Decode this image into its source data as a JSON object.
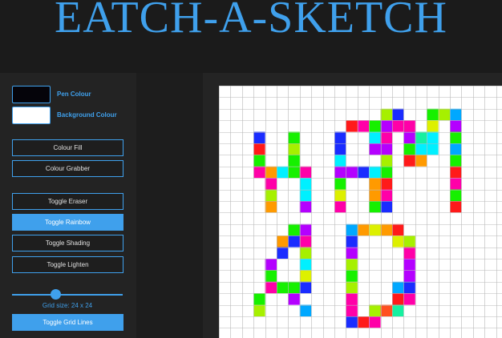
{
  "header": {
    "title": "EATCH-A-SKETCH"
  },
  "controls": {
    "pen_colour_label": "Pen Colour",
    "pen_colour_value": "#05040a",
    "background_colour_label": "Background Colour",
    "background_colour_value": "#ffffff",
    "colour_fill_label": "Colour Fill",
    "colour_grabber_label": "Colour Grabber",
    "toggle_eraser_label": "Toggle Eraser",
    "toggle_rainbow_label": "Toggle Rainbow",
    "toggle_shading_label": "Toggle Shading",
    "toggle_lighten_label": "Toggle Lighten",
    "grid_size_label": "Grid size: 24 x 24",
    "grid_size_value": 24,
    "toggle_grid_lines_label": "Toggle Grid Lines",
    "active_toggle": "Toggle Rainbow"
  },
  "colors": {
    "accent": "#3fa0ec",
    "grid_line": "#b8b8b8"
  },
  "sketch": {
    "palette": {
      "r": "#ff1a1a",
      "m": "#ff00a8",
      "p": "#b400ff",
      "b": "#1a2cff",
      "c": "#00f0ff",
      "g": "#16f000",
      "y": "#ddf000",
      "l": "#a6f000",
      "o": "#ff9a00",
      "n": "#ff5020",
      "s": "#00a8ff",
      "t": "#16f0a0"
    },
    "pixels": [
      [
        14,
        2,
        "l"
      ],
      [
        15,
        2,
        "b"
      ],
      [
        18,
        2,
        "g"
      ],
      [
        19,
        2,
        "l"
      ],
      [
        20,
        2,
        "s"
      ],
      [
        11,
        3,
        "r"
      ],
      [
        12,
        3,
        "m"
      ],
      [
        13,
        3,
        "g"
      ],
      [
        14,
        3,
        "p"
      ],
      [
        15,
        3,
        "m"
      ],
      [
        16,
        3,
        "m"
      ],
      [
        18,
        3,
        "y"
      ],
      [
        20,
        3,
        "p"
      ],
      [
        3,
        4,
        "b"
      ],
      [
        6,
        4,
        "g"
      ],
      [
        10,
        4,
        "b"
      ],
      [
        13,
        4,
        "c"
      ],
      [
        14,
        4,
        "m"
      ],
      [
        16,
        4,
        "p"
      ],
      [
        17,
        4,
        "t"
      ],
      [
        18,
        4,
        "c"
      ],
      [
        20,
        4,
        "g"
      ],
      [
        3,
        5,
        "r"
      ],
      [
        6,
        5,
        "l"
      ],
      [
        10,
        5,
        "b"
      ],
      [
        13,
        5,
        "p"
      ],
      [
        14,
        5,
        "p"
      ],
      [
        16,
        5,
        "g"
      ],
      [
        17,
        5,
        "c"
      ],
      [
        18,
        5,
        "c"
      ],
      [
        20,
        5,
        "s"
      ],
      [
        3,
        6,
        "g"
      ],
      [
        6,
        6,
        "g"
      ],
      [
        10,
        6,
        "c"
      ],
      [
        14,
        6,
        "l"
      ],
      [
        16,
        6,
        "r"
      ],
      [
        17,
        6,
        "o"
      ],
      [
        20,
        6,
        "g"
      ],
      [
        3,
        7,
        "m"
      ],
      [
        4,
        7,
        "o"
      ],
      [
        5,
        7,
        "c"
      ],
      [
        6,
        7,
        "g"
      ],
      [
        7,
        7,
        "m"
      ],
      [
        10,
        7,
        "p"
      ],
      [
        11,
        7,
        "p"
      ],
      [
        12,
        7,
        "b"
      ],
      [
        13,
        7,
        "c"
      ],
      [
        14,
        7,
        "g"
      ],
      [
        20,
        7,
        "r"
      ],
      [
        4,
        8,
        "m"
      ],
      [
        7,
        8,
        "c"
      ],
      [
        10,
        8,
        "g"
      ],
      [
        13,
        8,
        "o"
      ],
      [
        14,
        8,
        "r"
      ],
      [
        20,
        8,
        "m"
      ],
      [
        4,
        9,
        "l"
      ],
      [
        7,
        9,
        "c"
      ],
      [
        10,
        9,
        "y"
      ],
      [
        13,
        9,
        "o"
      ],
      [
        14,
        9,
        "m"
      ],
      [
        20,
        9,
        "g"
      ],
      [
        4,
        10,
        "o"
      ],
      [
        7,
        10,
        "p"
      ],
      [
        10,
        10,
        "m"
      ],
      [
        13,
        10,
        "g"
      ],
      [
        14,
        10,
        "b"
      ],
      [
        20,
        10,
        "r"
      ],
      [
        6,
        12,
        "g"
      ],
      [
        7,
        12,
        "p"
      ],
      [
        11,
        12,
        "s"
      ],
      [
        12,
        12,
        "o"
      ],
      [
        13,
        12,
        "y"
      ],
      [
        14,
        12,
        "o"
      ],
      [
        15,
        12,
        "r"
      ],
      [
        5,
        13,
        "o"
      ],
      [
        6,
        13,
        "b"
      ],
      [
        7,
        13,
        "m"
      ],
      [
        11,
        13,
        "b"
      ],
      [
        15,
        13,
        "y"
      ],
      [
        16,
        13,
        "l"
      ],
      [
        5,
        14,
        "b"
      ],
      [
        7,
        14,
        "l"
      ],
      [
        11,
        14,
        "p"
      ],
      [
        16,
        14,
        "m"
      ],
      [
        4,
        15,
        "p"
      ],
      [
        7,
        15,
        "c"
      ],
      [
        11,
        15,
        "l"
      ],
      [
        16,
        15,
        "p"
      ],
      [
        4,
        16,
        "g"
      ],
      [
        7,
        16,
        "y"
      ],
      [
        11,
        16,
        "g"
      ],
      [
        16,
        16,
        "p"
      ],
      [
        4,
        17,
        "m"
      ],
      [
        5,
        17,
        "g"
      ],
      [
        6,
        17,
        "g"
      ],
      [
        7,
        17,
        "b"
      ],
      [
        11,
        17,
        "l"
      ],
      [
        15,
        17,
        "s"
      ],
      [
        16,
        17,
        "b"
      ],
      [
        3,
        18,
        "g"
      ],
      [
        6,
        18,
        "p"
      ],
      [
        11,
        18,
        "m"
      ],
      [
        15,
        18,
        "r"
      ],
      [
        16,
        18,
        "m"
      ],
      [
        3,
        19,
        "l"
      ],
      [
        7,
        19,
        "s"
      ],
      [
        11,
        19,
        "m"
      ],
      [
        13,
        19,
        "l"
      ],
      [
        14,
        19,
        "n"
      ],
      [
        15,
        19,
        "t"
      ],
      [
        11,
        20,
        "b"
      ],
      [
        12,
        20,
        "r"
      ],
      [
        13,
        20,
        "m"
      ]
    ]
  }
}
